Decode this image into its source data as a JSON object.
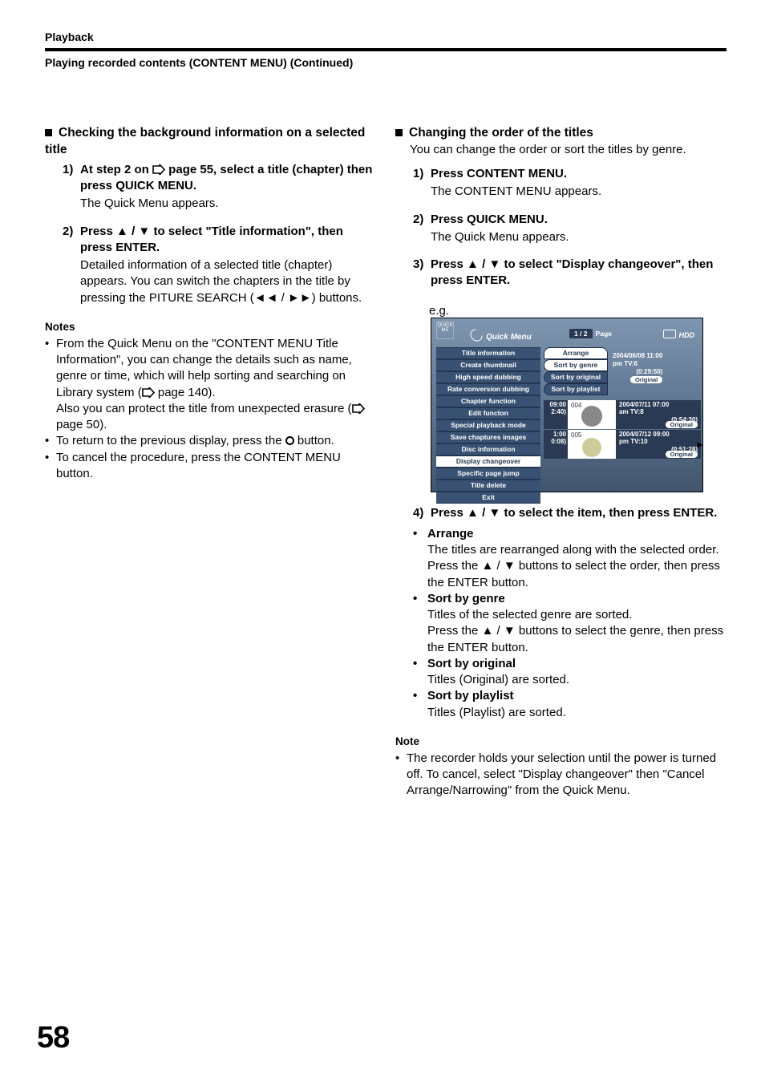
{
  "runhead": "Playback",
  "subtitle": "Playing recorded contents (CONTENT MENU) (Continued)",
  "page_number": "58",
  "left": {
    "heading": "Checking the background information on a selected title",
    "step1a": "At step 2 on ",
    "step1b": " page 55, select a title (chapter) then press QUICK MENU.",
    "step1body": "The Quick Menu appears.",
    "step2a": "Press ",
    "step2b": " to select \"Title information\", then press ENTER.",
    "step2body": "Detailed information of a selected title (chapter) appears. You can switch the chapters in the title by pressing the PITURE SEARCH (",
    "step2body_tail": ") buttons.",
    "notes_h": "Notes",
    "note1a": "From the Quick Menu on the \"CONTENT MENU Title Information\", you can change the details such as name, genre or time, which will help sorting and searching on Library system (",
    "note1b": " page 140).",
    "note1c": "Also you can protect the title from unexpected erasure (",
    "note1d": " page 50).",
    "note2a": "To return to the previous display, press the ",
    "note2b": " button.",
    "note3": "To cancel the procedure, press the CONTENT MENU button."
  },
  "right": {
    "heading": "Changing the order of the titles",
    "intro": "You can change the order or sort the titles by genre.",
    "step1": "Press CONTENT MENU.",
    "step1body": "The CONTENT MENU appears.",
    "step2": "Press QUICK MENU.",
    "step2body": "The Quick Menu appears.",
    "step3a": "Press ",
    "step3b": " to select \"Display changeover\", then press ENTER.",
    "eg_label": "e.g.",
    "step4a": "Press ",
    "step4b": " to select the item, then press ENTER.",
    "opt_arrange": "Arrange",
    "opt_arrange_body1": "The titles are rearranged along with the selected order.",
    "opt_arrange_body2a": "Press the ",
    "opt_arrange_body2b": " buttons to select the order, then press the ENTER button.",
    "opt_genre": "Sort by genre",
    "opt_genre_body1": "Titles of the selected genre are sorted.",
    "opt_genre_body2a": "Press the ",
    "opt_genre_body2b": " buttons to select the genre, then press the ENTER button.",
    "opt_original": "Sort by original",
    "opt_original_body": "Titles (Original) are sorted.",
    "opt_playlist": "Sort by playlist",
    "opt_playlist_body": "Titles (Playlist) are sorted.",
    "note_h": "Note",
    "note_body": "The recorder holds your selection until the power is turned off. To cancel, select \"Display changeover\" then \"Cancel Arrange/Narrowing\" from the Quick Menu."
  },
  "eg": {
    "qm_title": "Quick Menu",
    "page": "Page",
    "page_ctr": "1 / 2",
    "hdd": "HDD",
    "menu": [
      "Title information",
      "Create thumbnail",
      "High speed dubbing",
      "Rate conversion dubbing",
      "Chapter function",
      "Edit functon",
      "Special playback mode",
      "Save chaptures images",
      "Disc information",
      "Display changeover",
      "Specific page jump",
      "Title delete",
      "Exit"
    ],
    "sub": [
      "Arrange",
      "Sort by genre",
      "Sort by original",
      "Sort by playlist"
    ],
    "thumbs": [
      {
        "tl1": "09:00",
        "tl2": "2:40)",
        "num": "004",
        "date": "2004/07/11 07:00",
        "ch": "am  TV:8",
        "dur": "(0:54:30)",
        "orig": "Original"
      },
      {
        "tl1": "1:00",
        "tl2": "0:08)",
        "num": "005",
        "date": "2004/07/12 09:00",
        "ch": "pm  TV:10",
        "dur": "(0:51:28)",
        "orig": "Original"
      }
    ],
    "top_thumb": {
      "date": "2004/06/08 11:00",
      "ch": "pm  TV:6",
      "dur": "(0:29:50)",
      "orig": "Original"
    }
  }
}
